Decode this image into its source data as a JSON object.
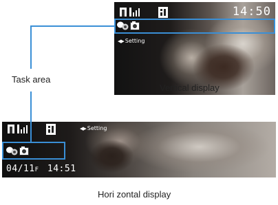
{
  "diagram": {
    "task_area_label": "Task area",
    "vertical_caption": "Vertical display",
    "horizontal_caption": "Hori zontal display"
  },
  "vertical_screen": {
    "clock": "14:50",
    "setting_label": "Setting",
    "status_icons": [
      "antenna-icon",
      "signal-icon",
      "foma-3g-icon"
    ],
    "task_icons": [
      "answer-machine-icon",
      "camera-icon"
    ]
  },
  "horizontal_screen": {
    "setting_label": "Setting",
    "date": "04/11",
    "weekday_char": "F",
    "clock": "14:51",
    "status_icons": [
      "antenna-icon",
      "signal-icon",
      "foma-3g-icon"
    ],
    "task_icons": [
      "answer-machine-icon",
      "camera-icon"
    ]
  },
  "colors": {
    "accent_line": "#3a8fd6",
    "caption_text": "#222222",
    "screen_text": "#ffffff"
  }
}
